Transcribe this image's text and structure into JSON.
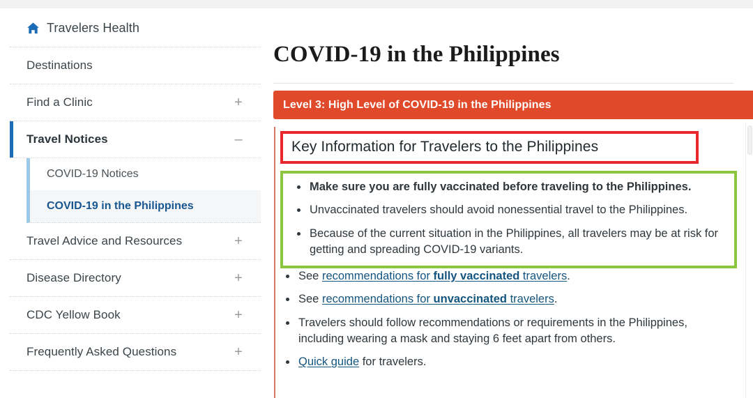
{
  "sidebar": {
    "home": {
      "label": "Travelers Health",
      "icon": "home-icon"
    },
    "items": [
      {
        "label": "Destinations",
        "toggle": ""
      },
      {
        "label": "Find a Clinic",
        "toggle": "+"
      },
      {
        "label": "Travel Notices",
        "toggle": "–"
      },
      {
        "label": "Travel Advice and Resources",
        "toggle": "+"
      },
      {
        "label": "Disease Directory",
        "toggle": "+"
      },
      {
        "label": "CDC Yellow Book",
        "toggle": "+"
      },
      {
        "label": "Frequently Asked Questions",
        "toggle": "+"
      }
    ],
    "subitems": [
      {
        "label": "COVID-19 Notices"
      },
      {
        "label": "COVID-19 in the Philippines"
      }
    ]
  },
  "main": {
    "page_title": "COVID-19 in the Philippines",
    "notice_banner": {
      "label": "Level 3: High Level of COVID-19 in the Philippines",
      "color": "#e0492a"
    },
    "key_info_heading": "Key Information for Travelers to the Philippines",
    "key_bullets": [
      "Make sure you are fully vaccinated before traveling to the Philippines.",
      "Unvaccinated travelers should avoid nonessential travel to the Philippines.",
      "Because of the current situation in the Philippines, all travelers may be at risk for getting and spreading COVID-19 variants."
    ],
    "link_bullets": {
      "fully_vaccinated": {
        "prefix": "See ",
        "link_pre": "recommendations for ",
        "link_bold": "fully vaccinated",
        "link_post": " travelers",
        "suffix": "."
      },
      "unvaccinated": {
        "prefix": "See ",
        "link_pre": "recommendations for ",
        "link_bold": "unvaccinated",
        "link_post": " travelers",
        "suffix": "."
      },
      "follow_recommendations": "Travelers should follow recommendations or requirements in the Philippines, including wearing a mask and staying 6 feet apart from others.",
      "quick_guide": {
        "link": "Quick guide",
        "suffix": " for travelers."
      }
    }
  },
  "annotations": {
    "heading_box_color": "#e9282e",
    "key_box_color": "#8cc63f"
  }
}
